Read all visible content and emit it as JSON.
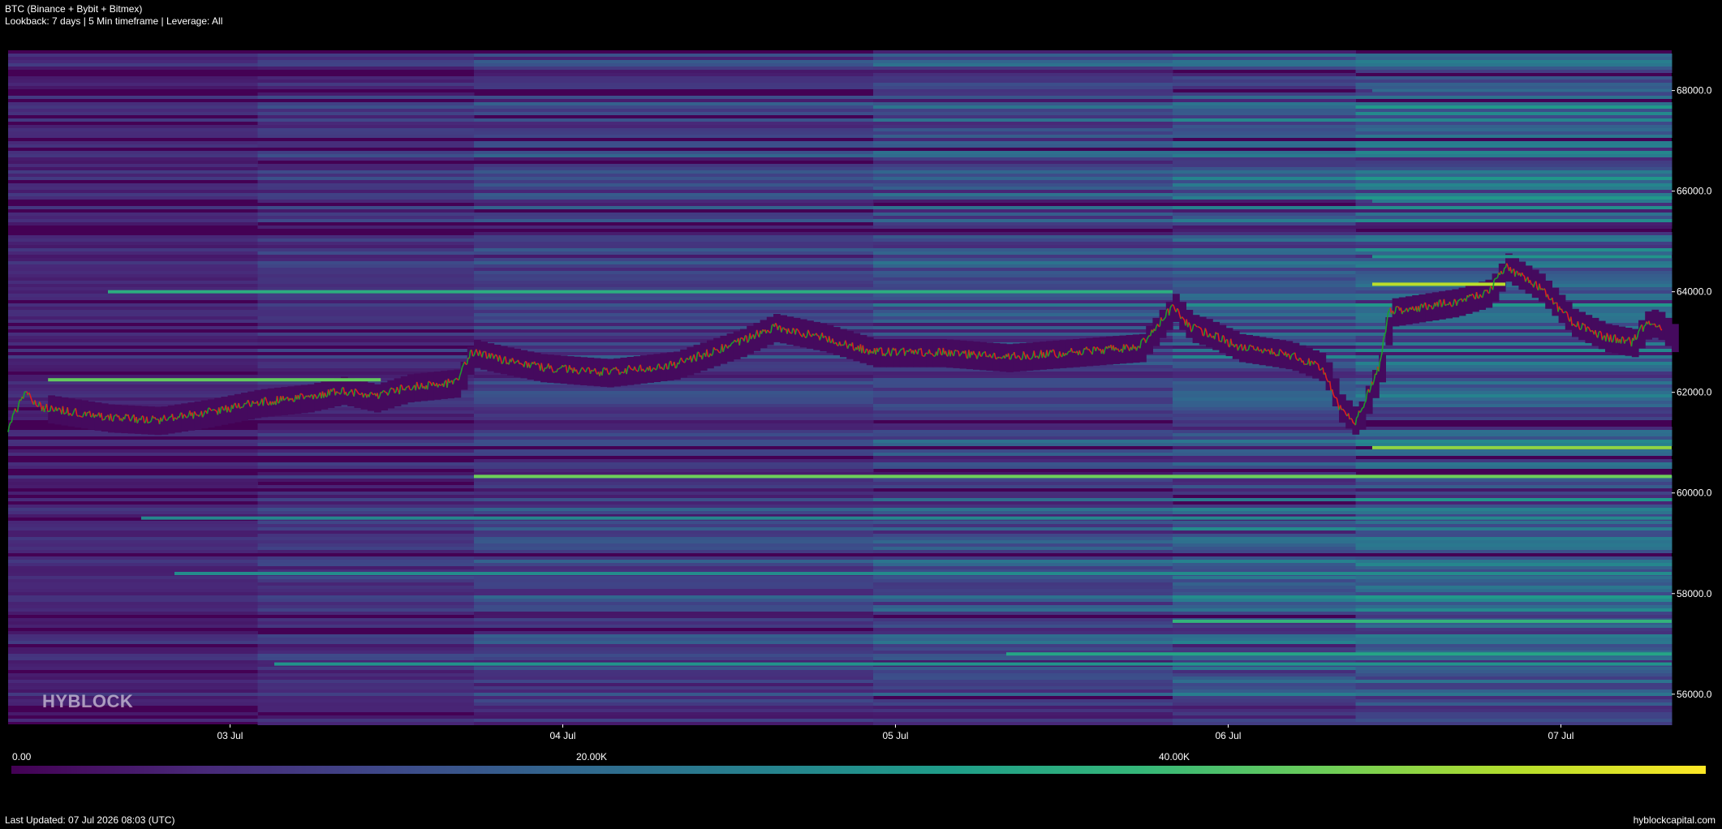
{
  "header": {
    "title": "BTC (Binance + Bybit + Bitmex)",
    "subtitle": "Lookback: 7 days | 5 Min timeframe | Leverage: All"
  },
  "watermark": "HYBLOCK",
  "footer": {
    "last_updated": "Last Updated: 07 Jul 2026 08:03 (UTC)",
    "site": "hyblockcapital.com"
  },
  "colorbar": {
    "ticks": [
      "0.00",
      "20.00K",
      "40.00K"
    ],
    "values": [
      0,
      20000,
      40000
    ],
    "max": 58000,
    "colormap": [
      "#440154",
      "#482878",
      "#3e4989",
      "#31688e",
      "#26828e",
      "#1f9e89",
      "#35b779",
      "#6ece58",
      "#b5de2b",
      "#fde725"
    ]
  },
  "chart_data": {
    "type": "heatmap",
    "title": "BTC (Binance + Bybit + Bitmex)",
    "subtitle": "Lookback: 7 days | 5 Min timeframe | Leverage: All",
    "x_start": "02 Jul 2026 08:00",
    "x_end": "07 Jul 2026 08:03",
    "x_ticks": [
      "03 Jul",
      "04 Jul",
      "05 Jul",
      "06 Jul",
      "07 Jul"
    ],
    "x_tick_days": [
      0.667,
      1.667,
      2.667,
      3.667,
      4.667
    ],
    "ylim": [
      55400,
      68800
    ],
    "y_ticks": [
      56000,
      58000,
      60000,
      62000,
      64000,
      66000,
      68000
    ],
    "y_tick_labels": [
      "56000.0",
      "58000.0",
      "60000.0",
      "62000.0",
      "64000.0",
      "66000.0",
      "68000.0"
    ],
    "y_axis_side": "right",
    "colorbar_label_position": "bottom",
    "price_series": {
      "name": "",
      "up_color": "#1e9e2e",
      "down_color": "#e0201e",
      "days": [
        0,
        0.05,
        0.1,
        0.2,
        0.3,
        0.45,
        0.6,
        0.75,
        0.9,
        1.0,
        1.1,
        1.2,
        1.35,
        1.39,
        1.45,
        1.6,
        1.8,
        2.0,
        2.2,
        2.3,
        2.45,
        2.6,
        2.8,
        3.0,
        3.2,
        3.4,
        3.5,
        3.55,
        3.6,
        3.7,
        3.85,
        3.95,
        4.0,
        4.05,
        4.12,
        4.15,
        4.25,
        4.35,
        4.45,
        4.5,
        4.55,
        4.6,
        4.7,
        4.8,
        4.88,
        4.92,
        4.95,
        5.0
      ],
      "prices": [
        61300,
        62000,
        61700,
        61600,
        61500,
        61450,
        61600,
        61800,
        61900,
        62050,
        61900,
        62100,
        62200,
        62800,
        62700,
        62500,
        62400,
        62550,
        63000,
        63300,
        63100,
        62800,
        62800,
        62700,
        62800,
        62900,
        63700,
        63300,
        63200,
        62900,
        62750,
        62500,
        61700,
        61400,
        62500,
        63600,
        63700,
        63800,
        64000,
        64500,
        64300,
        64100,
        63400,
        63100,
        63000,
        63350,
        63400,
        63100
      ]
    },
    "liquidation_levels": [
      {
        "price": 62250,
        "value": 44000,
        "start_day": 0.12,
        "end_day": 1.12
      },
      {
        "price": 64150,
        "value": 52000,
        "start_day": 4.1,
        "end_day": 4.5
      },
      {
        "price": 64000,
        "value": 36000,
        "start_day": 0.3,
        "end_day": 3.5
      },
      {
        "price": 60900,
        "value": 48000,
        "start_day": 4.1,
        "end_day": 5.0
      },
      {
        "price": 60330,
        "value": 45000,
        "start_day": 1.4,
        "end_day": 5.0
      },
      {
        "price": 57450,
        "value": 38000,
        "start_day": 3.5,
        "end_day": 5.0
      },
      {
        "price": 56800,
        "value": 34000,
        "start_day": 3.0,
        "end_day": 5.0
      },
      {
        "price": 56600,
        "value": 30000,
        "start_day": 0.8,
        "end_day": 5.0
      },
      {
        "price": 58400,
        "value": 28000,
        "start_day": 0.5,
        "end_day": 5.0
      },
      {
        "price": 59500,
        "value": 27000,
        "start_day": 0.4,
        "end_day": 5.0
      },
      {
        "price": 64700,
        "value": 30000,
        "start_day": 4.1,
        "end_day": 5.0
      },
      {
        "price": 65800,
        "value": 24000,
        "start_day": 4.1,
        "end_day": 5.0
      },
      {
        "price": 68000,
        "value": 20000,
        "start_day": 4.1,
        "end_day": 5.0
      }
    ]
  }
}
